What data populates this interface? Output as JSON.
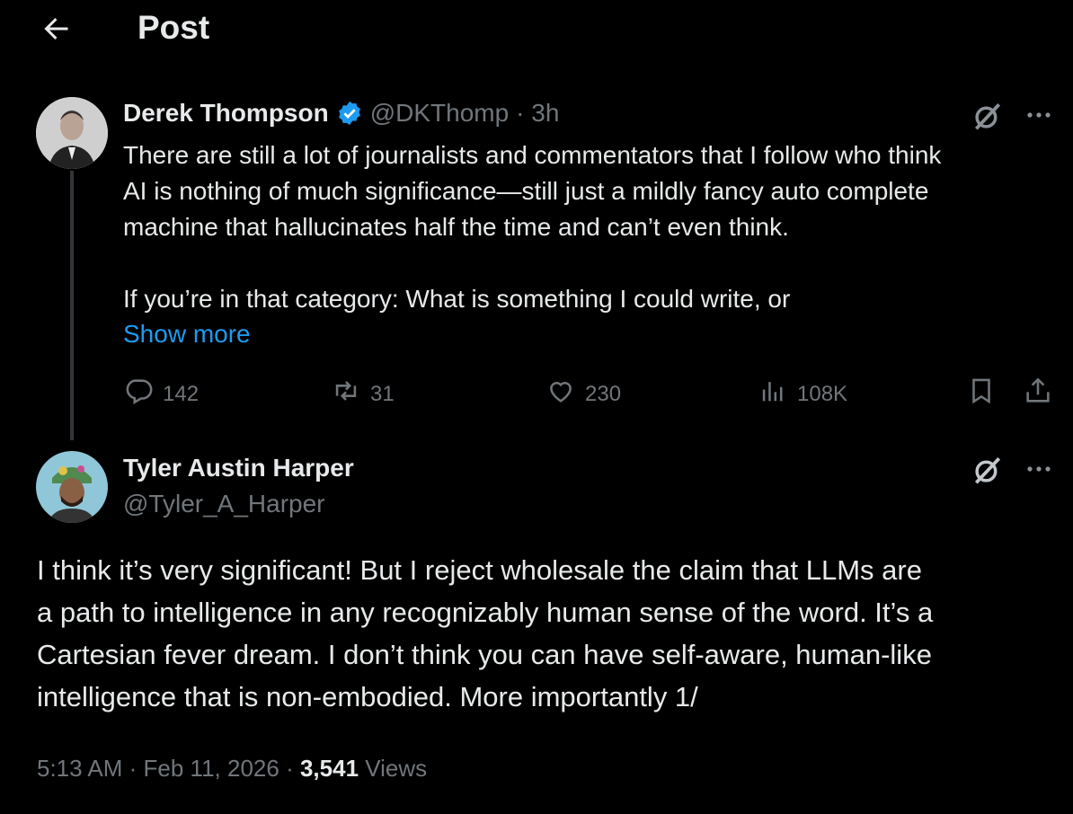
{
  "header": {
    "title": "Post"
  },
  "parent_post": {
    "author_name": "Derek Thompson",
    "handle": "@DKThomp",
    "time": "· 3h",
    "text": "There are still a lot of journalists and commentators that I follow who think\nAI is nothing of much significance—still just a mildly fancy auto complete\nmachine that hallucinates half the time and can’t even think.\n\nIf you’re in that category: What is something I could write, or",
    "show_more": "Show more",
    "replies": "142",
    "reposts": "31",
    "likes": "230",
    "views": "108K"
  },
  "reply_post": {
    "author_name": "Tyler Austin Harper",
    "handle": "@Tyler_A_Harper",
    "text_lines": [
      "I think it’s very significant! But I reject wholesale the claim that LLMs are",
      "a path to intelligence in any recognizably human sense of the word. It’s a",
      "Cartesian fever dream. I don’t think you can have self-aware, human-like",
      "intelligence that is non-embodied. More importantly 1/"
    ],
    "time": "5:13 AM",
    "date": "Feb 11, 2026",
    "views_count": "3,541",
    "views_label": "Views"
  },
  "colors": {
    "accent": "#1d9bf0",
    "muted": "#71767b",
    "text": "#e7e9ea",
    "bg": "#000000"
  }
}
